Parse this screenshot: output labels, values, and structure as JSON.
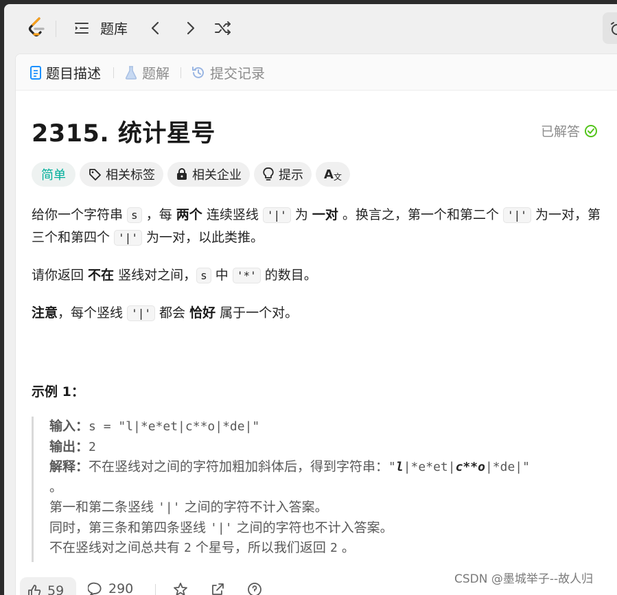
{
  "topbar": {
    "title": "题库",
    "logo_icon": "leetcode-logo",
    "list_icon": "list-indent-icon",
    "prev_icon": "chevron-left-icon",
    "next_icon": "chevron-right-icon",
    "shuffle_icon": "shuffle-icon"
  },
  "tabs": [
    {
      "label": "题目描述",
      "icon": "document-icon",
      "active": true
    },
    {
      "label": "题解",
      "icon": "flask-icon",
      "active": false
    },
    {
      "label": "提交记录",
      "icon": "history-icon",
      "active": false
    }
  ],
  "problem": {
    "title": "2315. 统计星号",
    "status": "已解答",
    "status_color": "#52c41a"
  },
  "tags": {
    "difficulty": "简单",
    "related_tags": "相关标签",
    "related_companies": "相关企业",
    "hint": "提示",
    "translate_label": "A"
  },
  "description": {
    "p1": {
      "t1": "给你一个字符串 ",
      "c1": "s",
      "t2": " ，每 ",
      "b1": "两个",
      "t3": " 连续竖线 ",
      "c2": "'|'",
      "t4": " 为 ",
      "b2": "一对",
      "t5": " 。换言之，第一个和第二个 ",
      "c3": "'|'",
      "t6": " 为一对，第三个和第四个 ",
      "c4": "'|'",
      "t7": " 为一对，以此类推。"
    },
    "p2": {
      "t1": "请你返回 ",
      "b1": "不在",
      "t2": " 竖线对之间，",
      "c1": "s",
      "t3": " 中 ",
      "c2": "'*'",
      "t4": " 的数目。"
    },
    "p3": {
      "b1": "注意",
      "t1": "，每个竖线 ",
      "c1": "'|'",
      "t2": " 都会 ",
      "b2": "恰好",
      "t3": " 属于一个对。"
    }
  },
  "example": {
    "title": "示例 1：",
    "input_label": "输入：",
    "input_value": "s = \"l|*e*et|c**o|*de|\"",
    "output_label": "输出：",
    "output_value": "2",
    "explain_label": "解释：",
    "explain_text": "不在竖线对之间的字符加粗加斜体后，得到字符串：",
    "explain_q1": "\"",
    "explain_bi1": "l",
    "explain_m1": "|*e*et|",
    "explain_bi2": "c**o",
    "explain_m2": "|*de|\"",
    "explain_end": "。",
    "line4_a": "第一和第二条竖线 ",
    "line4_c": "'|'",
    "line4_b": " 之间的字符不计入答案。",
    "line5_a": "同时，第三条和第四条竖线 ",
    "line5_c": "'|'",
    "line5_b": " 之间的字符也不计入答案。",
    "line6_a": "不在竖线对之间总共有 ",
    "line6_c": "2",
    "line6_b": " 个星号，所以我们返回 ",
    "line6_d": "2",
    "line6_e": " 。"
  },
  "footer": {
    "likes": "59",
    "comments": "290"
  },
  "watermark": "CSDN @墨城举子--故人归"
}
